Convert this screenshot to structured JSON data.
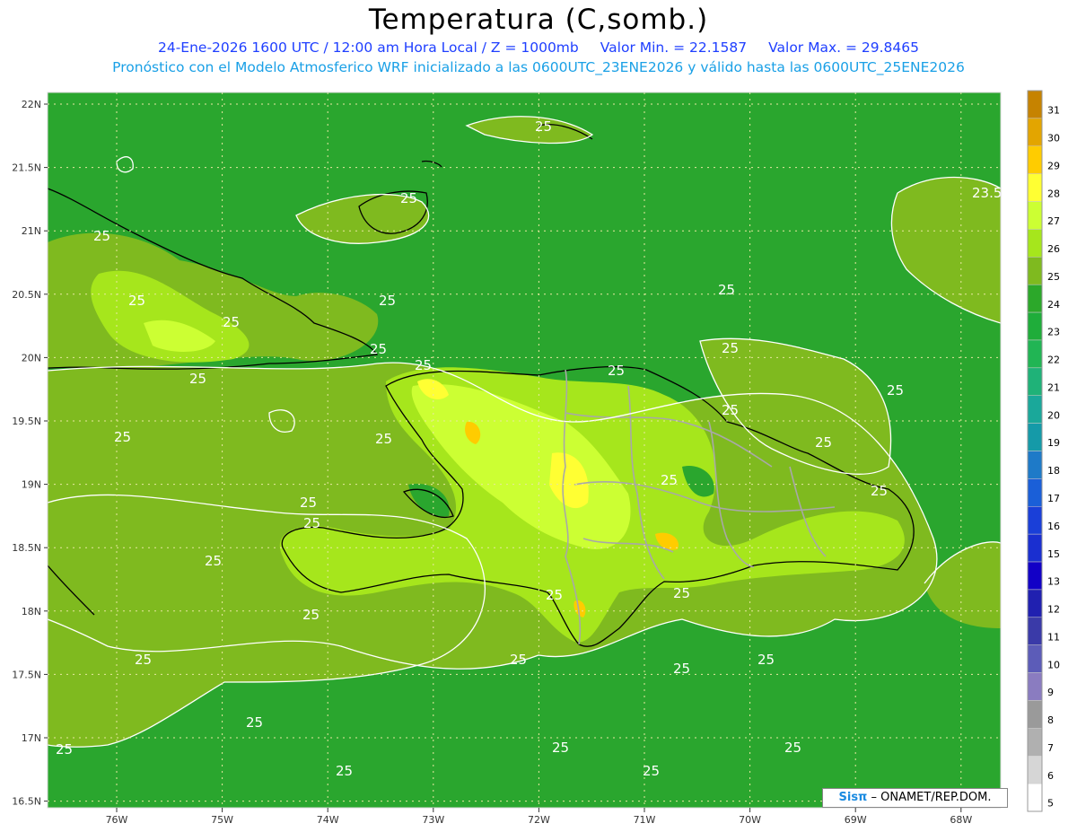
{
  "header": {
    "title": "Temperatura (C,somb.)",
    "date_line": "24-Ene-2026 1600 UTC / 12:00 am Hora Local / Z = 1000mb",
    "min_label": "Valor Min. = 22.1587",
    "max_label": "Valor Max. = 29.8465",
    "model_line": "Pronóstico con el Modelo Atmosferico WRF inicializado a las 0600UTC_23ENE2026 y válido hasta las  0600UTC_25ENE2026"
  },
  "credit": {
    "brand": "Sisπ",
    "org": " – ONAMET/REP.DOM."
  },
  "axes": {
    "lat_labels": [
      "22N",
      "21.5N",
      "21N",
      "20.5N",
      "20N",
      "19.5N",
      "19N",
      "18.5N",
      "18N",
      "17.5N",
      "17N",
      "16.5N"
    ],
    "lon_labels": [
      "76W",
      "75W",
      "74W",
      "73W",
      "72W",
      "71W",
      "70W",
      "69W",
      "68W"
    ]
  },
  "colorbar": {
    "labels": [
      "31",
      "30",
      "29",
      "28",
      "27",
      "26",
      "25",
      "24",
      "23",
      "22",
      "21",
      "20",
      "19",
      "18",
      "17",
      "16",
      "15",
      "13",
      "12",
      "11",
      "10",
      "9",
      "8",
      "7",
      "6",
      "5"
    ],
    "colors": [
      "#c68300",
      "#e3a500",
      "#ffcc00",
      "#ffff33",
      "#ccff33",
      "#a6e61c",
      "#7fba1f",
      "#2ca82a",
      "#1fad3a",
      "#21b554",
      "#1fb278",
      "#1aa89a",
      "#159aa8",
      "#1e7ac8",
      "#1a5fd8",
      "#1a3fd8",
      "#1a2fd0",
      "#1200c6",
      "#2020b0",
      "#3a3aa8",
      "#5c5cb8",
      "#8a7cc0",
      "#9a9a9a",
      "#b0b0b0",
      "#d6d6d6",
      "#ffffff"
    ]
  },
  "contour_labels": [
    "25",
    "23.5"
  ],
  "colors": {
    "sea": "#2aa62e",
    "contour": "#ffffff",
    "coast": "#000000",
    "border": "#a8a8a8"
  }
}
